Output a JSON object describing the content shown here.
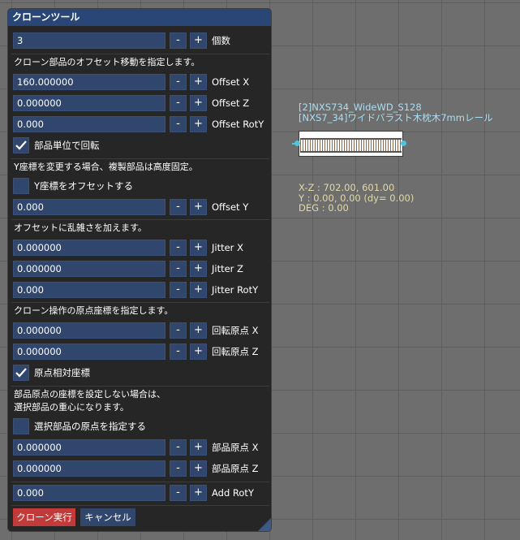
{
  "panel": {
    "title": "クローンツール",
    "count": {
      "value": "3",
      "label": "個数"
    },
    "offset": {
      "heading": "クローン部品のオフセット移動を指定します。",
      "rows": [
        {
          "value": "160.000000",
          "label": "Offset X"
        },
        {
          "value": "0.000000",
          "label": "Offset Z"
        },
        {
          "value": "0.000",
          "label": "Offset RotY"
        }
      ],
      "rotate_checkbox": {
        "label": "部品単位で回転",
        "checked": true
      }
    },
    "y": {
      "heading": "Y座標を変更する場合、複製部品は高度固定。",
      "checkbox": {
        "label": "Y座標をオフセットする",
        "checked": false
      },
      "row": {
        "value": "0.000",
        "label": "Offset Y"
      }
    },
    "jitter": {
      "heading": "オフセットに乱雑さを加えます。",
      "rows": [
        {
          "value": "0.000000",
          "label": "Jitter X"
        },
        {
          "value": "0.000000",
          "label": "Jitter Z"
        },
        {
          "value": "0.000",
          "label": "Jitter RotY"
        }
      ]
    },
    "origin": {
      "heading": "クローン操作の原点座標を指定します。",
      "rows": [
        {
          "value": "0.000000",
          "label": "回転原点 X"
        },
        {
          "value": "0.000000",
          "label": "回転原点 Z"
        }
      ],
      "checkbox": {
        "label": "原点相対座標",
        "checked": true
      }
    },
    "part_origin": {
      "heading_line1": "部品原点の座標を設定しない場合は、",
      "heading_line2": "選択部品の重心になります。",
      "checkbox": {
        "label": "選択部品の原点を指定する",
        "checked": false
      },
      "rows": [
        {
          "value": "0.000000",
          "label": "部品原点 X"
        },
        {
          "value": "0.000000",
          "label": "部品原点 Z"
        }
      ]
    },
    "add_rot": {
      "value": "0.000",
      "label": "Add RotY"
    },
    "minus_label": "-",
    "plus_label": "+",
    "clone_button": "クローン実行",
    "cancel_button": "キャンセル"
  },
  "viewport": {
    "part_line1": "[2]NXS734_WideWD_S128",
    "part_line2": "[NXS7_34]ワイドバラスト木枕木7mmレール",
    "coord_line1": "X-Z :  702.00,  601.00",
    "coord_line2": "Y :    0.00,     0.00 (dy=    0.00)",
    "coord_line3": "DEG : 0.00"
  },
  "colors": {
    "accent": "#30466c",
    "title_bar": "#2a4677",
    "clone_button": "#c33a3a",
    "part_text": "#a9dff2",
    "coord_text": "#e3d9a6",
    "handle": "#4ec5e0"
  },
  "icons": [
    "checkmark-icon",
    "resize-corner-icon"
  ]
}
